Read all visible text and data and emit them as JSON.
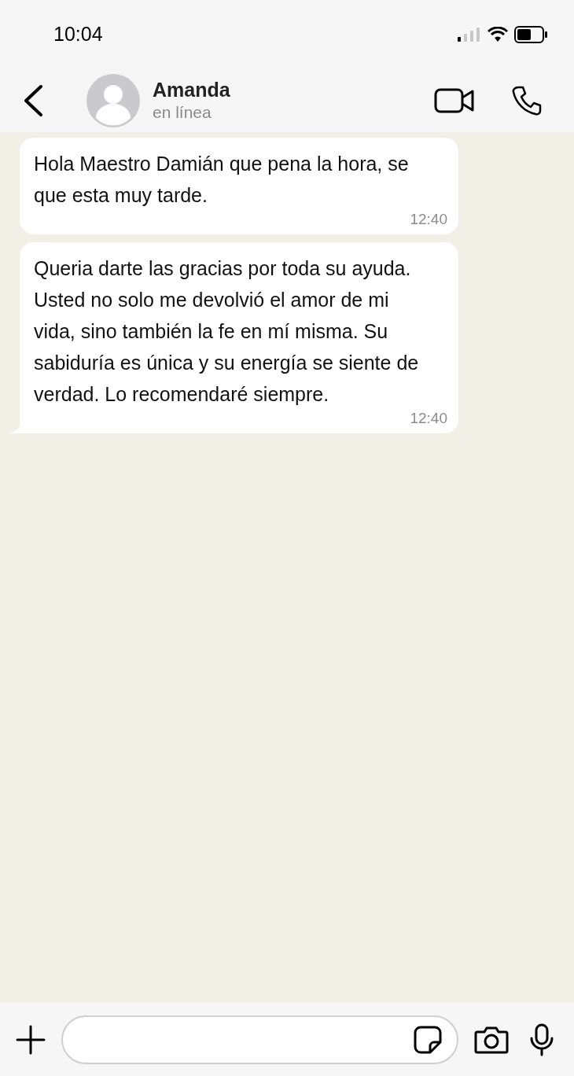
{
  "status_bar": {
    "time": "10:04"
  },
  "header": {
    "name": "Amanda",
    "status": "en línea"
  },
  "messages": [
    {
      "text": "Hola Maestro Damián que pena la hora, se que esta muy tarde.",
      "time": "12:40",
      "tail": false
    },
    {
      "text": "Queria darte las gracias por toda su ayuda. Usted no solo me devolvió el amor de mi vida, sino también la fe en mí misma. Su sabiduría es única y su energía se siente de verdad. Lo recomendaré siempre.",
      "time": "12:40",
      "tail": true
    }
  ]
}
